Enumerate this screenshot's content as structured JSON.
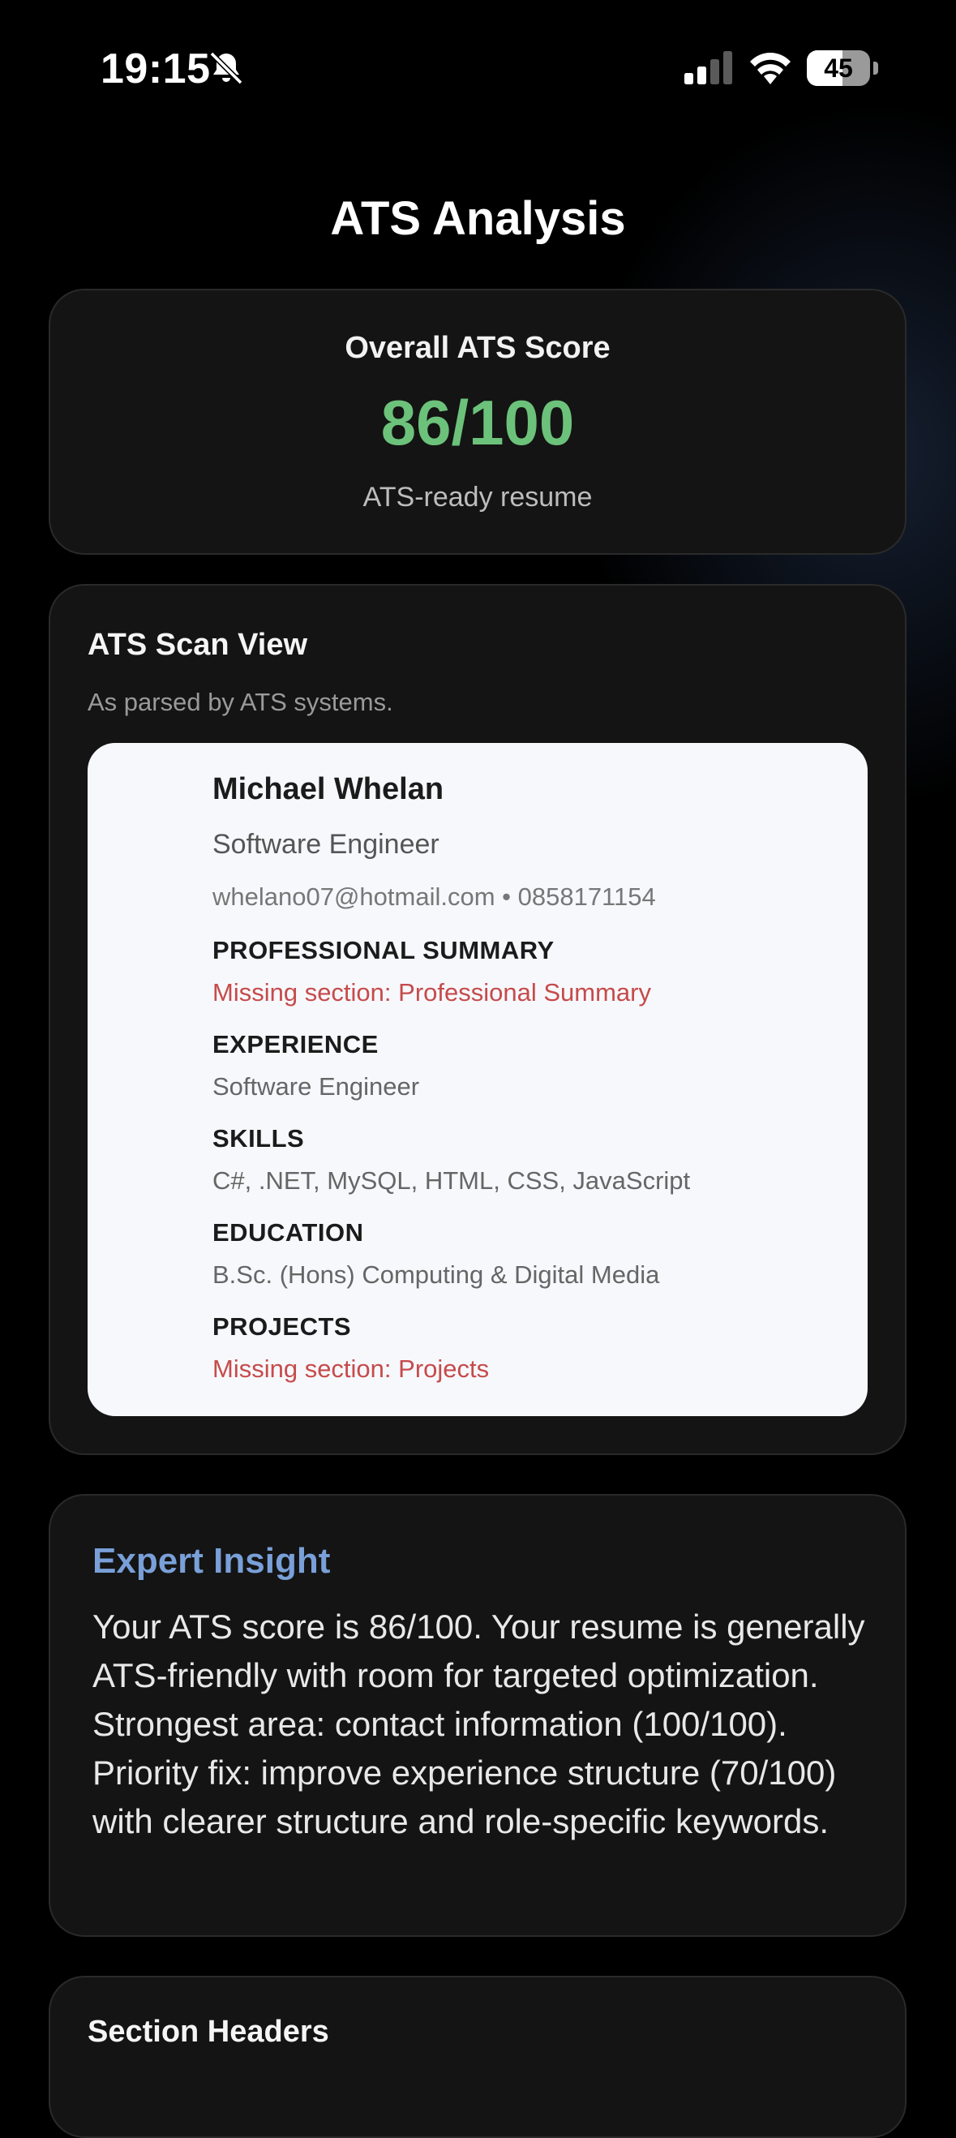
{
  "status_bar": {
    "time": "19:15",
    "battery": "45",
    "icons": [
      "bell-slash-icon",
      "cellular-signal-icon",
      "wifi-icon",
      "battery-icon"
    ]
  },
  "page": {
    "title": "ATS Analysis"
  },
  "score": {
    "label": "Overall ATS Score",
    "value": "86/100",
    "value_color": "#6cc27a",
    "subtitle": "ATS-ready resume"
  },
  "scan_view": {
    "title": "ATS Scan View",
    "subtitle": "As parsed by ATS systems.",
    "resume": {
      "name": "Michael Whelan",
      "role": "Software Engineer",
      "contact": "whelano07@hotmail.com • 0858171154",
      "sections": [
        {
          "heading": "PROFESSIONAL SUMMARY",
          "text": "Missing section: Professional Summary",
          "missing": true
        },
        {
          "heading": "EXPERIENCE",
          "text": "Software Engineer",
          "missing": false
        },
        {
          "heading": "SKILLS",
          "text": "C#, .NET, MySQL, HTML, CSS, JavaScript",
          "missing": false
        },
        {
          "heading": "EDUCATION",
          "text": "B.Sc. (Hons) Computing & Digital Media",
          "missing": false
        },
        {
          "heading": "PROJECTS",
          "text": "Missing section: Projects",
          "missing": true
        }
      ]
    }
  },
  "insight": {
    "title": "Expert Insight",
    "body": "Your ATS score is 86/100. Your resume is generally ATS-friendly with room for targeted optimization. Strongest area: contact information (100/100). Priority fix: improve experience structure (70/100) with clearer structure and role-specific keywords."
  },
  "section_headers": {
    "title": "Section Headers"
  },
  "colors": {
    "background": "#000000",
    "card": "#141414",
    "accent_green": "#6cc27a",
    "accent_blue": "#79a0d8",
    "missing_red": "#c64b4b"
  }
}
